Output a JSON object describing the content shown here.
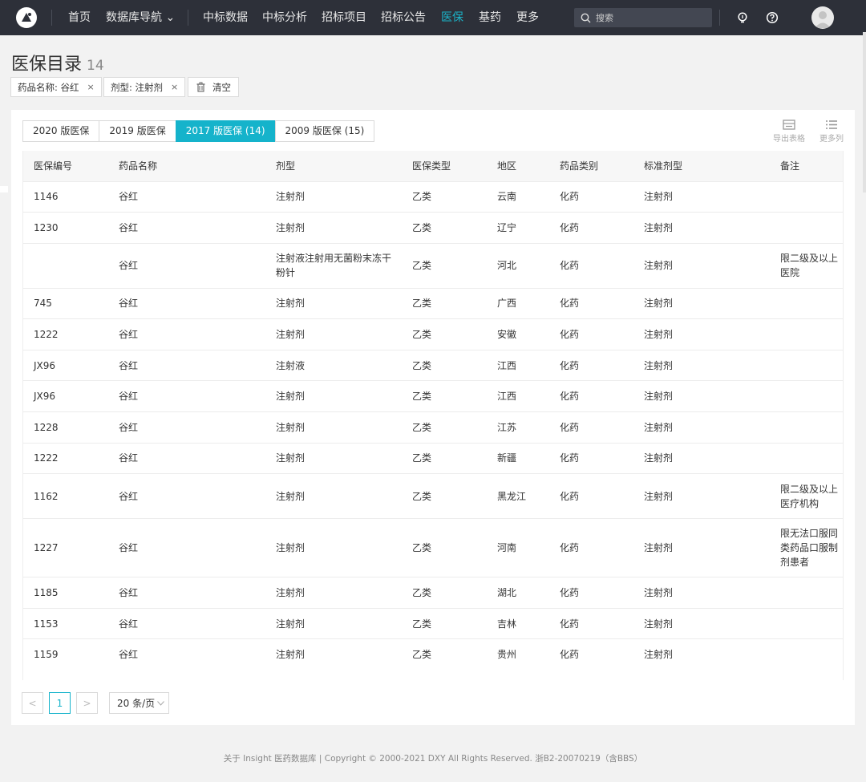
{
  "nav": {
    "items": [
      {
        "label": "首页",
        "active": false
      },
      {
        "label": "数据库导航 ⌄",
        "active": false
      },
      {
        "label": "中标数据",
        "active": false
      },
      {
        "label": "中标分析",
        "active": false
      },
      {
        "label": "招标项目",
        "active": false
      },
      {
        "label": "招标公告",
        "active": false
      },
      {
        "label": "医保",
        "active": true
      },
      {
        "label": "基药",
        "active": false
      },
      {
        "label": "更多",
        "active": false
      }
    ],
    "search_placeholder": "搜索",
    "icons": [
      "logo-icon",
      "search-icon",
      "bulb-icon",
      "help-icon",
      "avatar"
    ],
    "accent_color": "#1bb3c8",
    "bg_color": "#2d3039"
  },
  "page": {
    "title": "医保目录",
    "count": "14"
  },
  "filters": {
    "chips": [
      {
        "label": "药品名称: 谷红",
        "close": "×"
      },
      {
        "label": "剂型: 注射剂",
        "close": "×"
      }
    ],
    "clear_label": "清空"
  },
  "tabs": [
    {
      "label": "2020 版医保",
      "active": false
    },
    {
      "label": "2019 版医保",
      "active": false
    },
    {
      "label": "2017 版医保 (14)",
      "active": true
    },
    {
      "label": "2009 版医保 (15)",
      "active": false
    }
  ],
  "tools": {
    "export_label": "导出表格",
    "more_cols_label": "更多列"
  },
  "table": {
    "columns": [
      "医保编号",
      "药品名称",
      "剂型",
      "医保类型",
      "地区",
      "药品类别",
      "标准剂型",
      "备注"
    ],
    "rows": [
      {
        "code": "1146",
        "name": "谷红",
        "form": "注射剂",
        "type": "乙类",
        "region": "云南",
        "category": "化药",
        "std_form": "注射剂",
        "note": "",
        "h": "h1"
      },
      {
        "code": "1230",
        "name": "谷红",
        "form": "注射剂",
        "type": "乙类",
        "region": "辽宁",
        "category": "化药",
        "std_form": "注射剂",
        "note": "",
        "h": "h1"
      },
      {
        "code": "",
        "name": "谷红",
        "form": "注射液注射用无菌粉末冻干粉针",
        "type": "乙类",
        "region": "河北",
        "category": "化药",
        "std_form": "注射剂",
        "note": "限二级及以上医院",
        "h": "h2"
      },
      {
        "code": "745",
        "name": "谷红",
        "form": "注射剂",
        "type": "乙类",
        "region": "广西",
        "category": "化药",
        "std_form": "注射剂",
        "note": "",
        "h": "h1"
      },
      {
        "code": "1222",
        "name": "谷红",
        "form": "注射剂",
        "type": "乙类",
        "region": "安徽",
        "category": "化药",
        "std_form": "注射剂",
        "note": "",
        "h": "h1"
      },
      {
        "code": "JX96",
        "name": "谷红",
        "form": "注射液",
        "type": "乙类",
        "region": "江西",
        "category": "化药",
        "std_form": "注射剂",
        "note": "",
        "h": "h1"
      },
      {
        "code": "JX96",
        "name": "谷红",
        "form": "注射剂",
        "type": "乙类",
        "region": "江西",
        "category": "化药",
        "std_form": "注射剂",
        "note": "",
        "h": "h1"
      },
      {
        "code": "1228",
        "name": "谷红",
        "form": "注射剂",
        "type": "乙类",
        "region": "江苏",
        "category": "化药",
        "std_form": "注射剂",
        "note": "",
        "h": "h1"
      },
      {
        "code": "1222",
        "name": "谷红",
        "form": "注射剂",
        "type": "乙类",
        "region": "新疆",
        "category": "化药",
        "std_form": "注射剂",
        "note": "",
        "h": "h1"
      },
      {
        "code": "1162",
        "name": "谷红",
        "form": "注射剂",
        "type": "乙类",
        "region": "黑龙江",
        "category": "化药",
        "std_form": "注射剂",
        "note": "限二级及以上医疗机构",
        "h": "h2"
      },
      {
        "code": "1227",
        "name": "谷红",
        "form": "注射剂",
        "type": "乙类",
        "region": "河南",
        "category": "化药",
        "std_form": "注射剂",
        "note": "限无法口服同类药品口服制剂患者",
        "h": "h3"
      },
      {
        "code": "1185",
        "name": "谷红",
        "form": "注射剂",
        "type": "乙类",
        "region": "湖北",
        "category": "化药",
        "std_form": "注射剂",
        "note": "",
        "h": "h1"
      },
      {
        "code": "1153",
        "name": "谷红",
        "form": "注射剂",
        "type": "乙类",
        "region": "吉林",
        "category": "化药",
        "std_form": "注射剂",
        "note": "",
        "h": "h1"
      },
      {
        "code": "1159",
        "name": "谷红",
        "form": "注射剂",
        "type": "乙类",
        "region": "贵州",
        "category": "化药",
        "std_form": "注射剂",
        "note": "",
        "h": "h1"
      }
    ]
  },
  "pagination": {
    "prev": "<",
    "current": "1",
    "next": ">",
    "page_size": "20 条/页"
  },
  "footer": {
    "text": "关于 Insight 医药数据库  |  Copyright © 2000-2021 DXY All Rights Reserved. 浙B2-20070219（含BBS）"
  }
}
